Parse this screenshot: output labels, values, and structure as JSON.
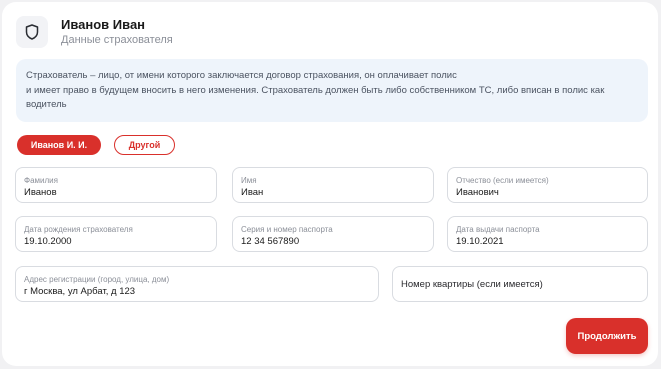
{
  "header": {
    "name": "Иванов Иван",
    "subtitle": "Данные страхователя",
    "icon": "shield-icon"
  },
  "info": {
    "line1": "Страхователь – лицо, от имени которого заключается договор страхования, он оплачивает полис",
    "line2": "и имеет право в будущем вносить в него изменения. Страхователь должен быть либо собственником ТС, либо вписан в полис как",
    "line3": "водитель"
  },
  "selector": {
    "active": "Иванов И. И.",
    "other": "Другой"
  },
  "fields": {
    "last_name": {
      "label": "Фамилия",
      "value": "Иванов"
    },
    "first_name": {
      "label": "Имя",
      "value": "Иван"
    },
    "patronymic": {
      "label": "Отчество (если имеется)",
      "value": "Иванович"
    },
    "birth_date": {
      "label": "Дата рождения страхователя",
      "value": "19.10.2000"
    },
    "passport": {
      "label": "Серия и номер паспорта",
      "value": "12 34 567890"
    },
    "passport_date": {
      "label": "Дата выдачи паспорта",
      "value": "19.10.2021"
    },
    "address": {
      "label": "Адрес регистрации (город, улица, дом)",
      "value": "г Москва, ул Арбат, д 123"
    },
    "apartment": {
      "placeholder": "Номер квартиры (если имеется)"
    }
  },
  "actions": {
    "continue_label": "Продолжить"
  },
  "colors": {
    "accent": "#d9302b",
    "info_bg": "#eef4fb"
  }
}
